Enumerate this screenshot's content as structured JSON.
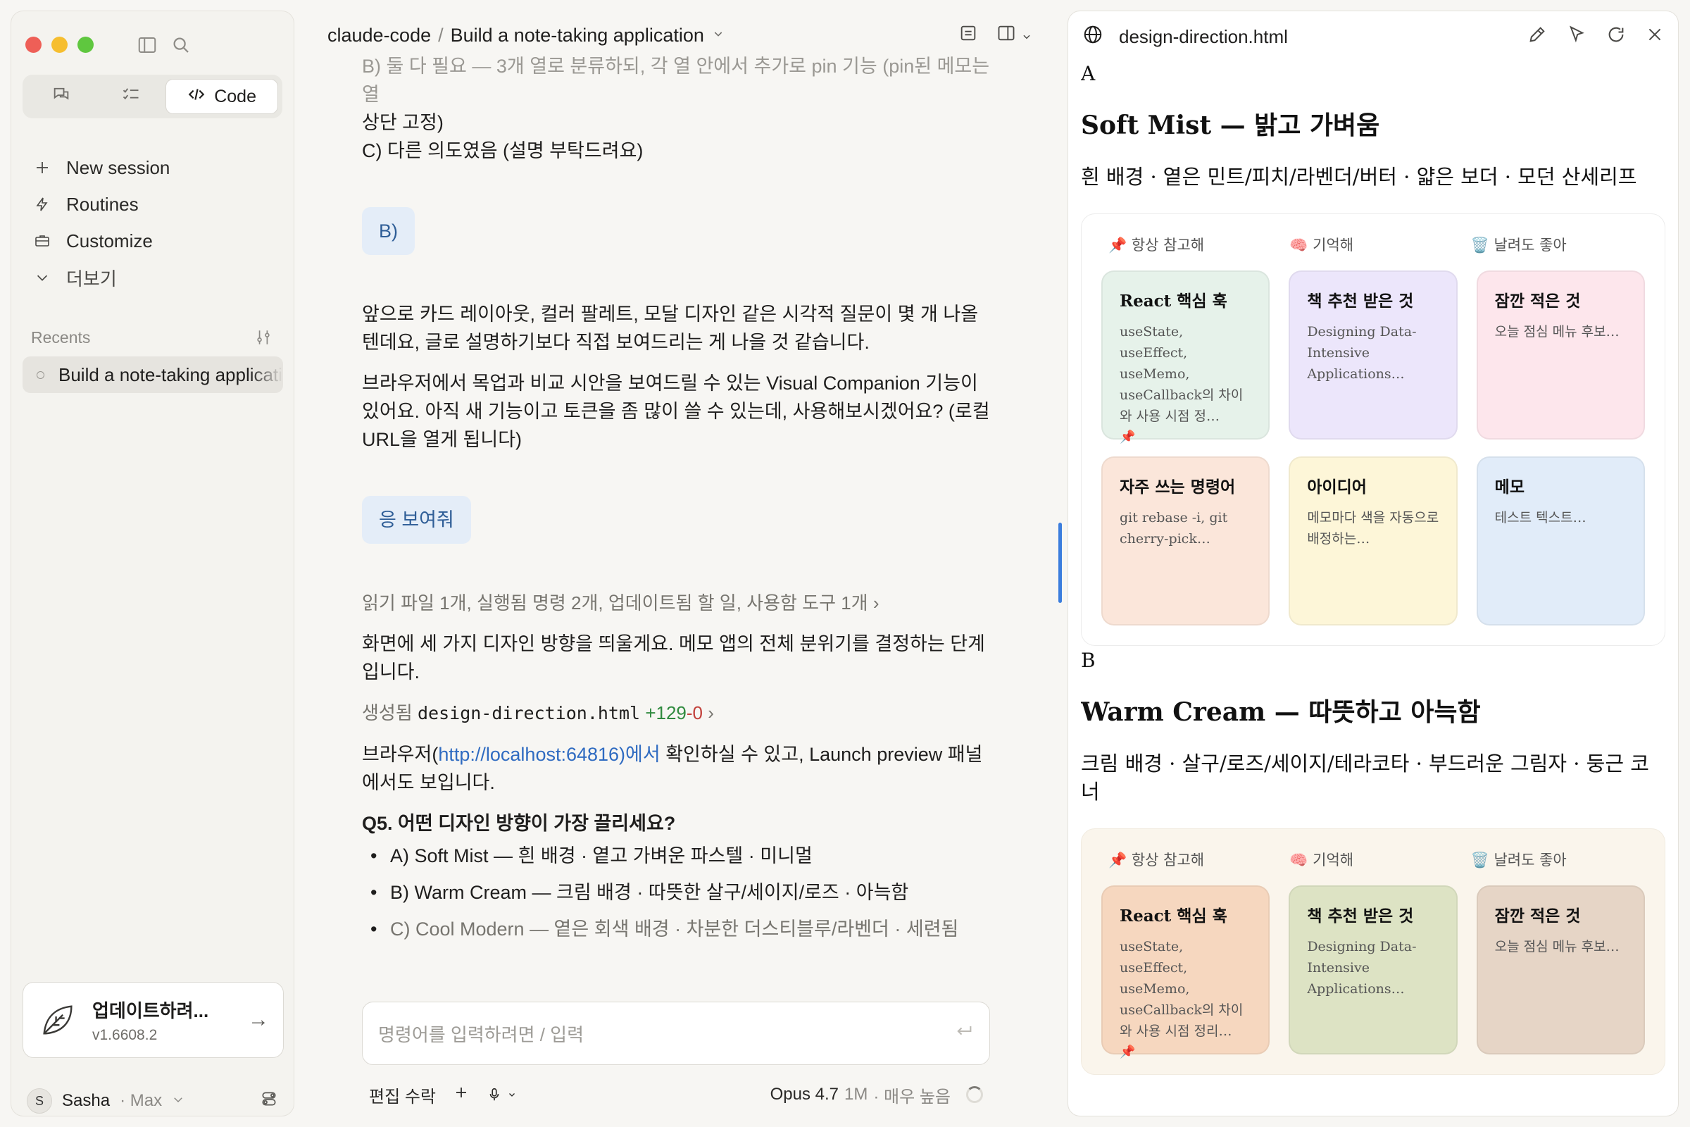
{
  "sidebar": {
    "mode_tabs": [
      {
        "icon": "chat-bubbles-icon"
      },
      {
        "icon": "checklist-icon"
      },
      {
        "icon": "code-brackets-icon",
        "label": "Code"
      }
    ],
    "nav": [
      {
        "label": "New session",
        "icon": "plus-icon"
      },
      {
        "label": "Routines",
        "icon": "bolt-icon"
      },
      {
        "label": "Customize",
        "icon": "briefcase-icon"
      },
      {
        "label": "더보기",
        "icon": "chevron-down-icon"
      }
    ],
    "recents_label": "Recents",
    "recent_item": "Build a note-taking application",
    "update": {
      "title": "업데이트하려...",
      "version": "v1.6608.2"
    },
    "user": {
      "initial": "S",
      "name": "Sasha",
      "plan": "· Max"
    }
  },
  "topbar": {
    "repo": "claude-code",
    "separator": "/",
    "title": "Build a note-taking application"
  },
  "chat": {
    "cut_line": "B) 둘 다 필요 — 3개 열로 분류하되, 각 열 안에서 추가로 pin 기능 (pin된 메모는 열",
    "cut_line2": "상단 고정)",
    "opt_c": "C) 다른 의도였음 (설명 부탁드려요)",
    "user_reply1": "B)",
    "para1": "앞으로 카드 레이아웃, 컬러 팔레트, 모달 디자인 같은 시각적 질문이 몇 개 나올 텐데요, 글로 설명하기보다 직접 보여드리는 게 나을 것 같습니다.",
    "para2": "브라우저에서 목업과 비교 시안을 보여드릴 수 있는 Visual Companion 기능이 있어요. 아직 새 기능이고 토큰을 좀 많이 쓸 수 있는데, 사용해보시겠어요? (로컬 URL을 열게 됩니다)",
    "user_reply2": "응 보여줘",
    "tool_summary": "읽기 파일 1개, 실행됨 명령 2개, 업데이트됨 할 일, 사용함 도구 1개",
    "para3": "화면에 세 가지 디자인 방향을 띄울게요. 메모 앱의 전체 분위기를 결정하는 단계입니다.",
    "created_label": "생성됨",
    "created_file": "design-direction.html",
    "diff_plus": "+129",
    "diff_minus": "-0",
    "browser_pre": "브라우저(",
    "browser_link": "http://localhost:64816)에서",
    "browser_post": " 확인하실 수 있고, Launch preview 패널에서도 보입니다.",
    "question": "Q5. 어떤 디자인 방향이 가장 끌리세요?",
    "options": [
      {
        "key": "A) Soft Mist",
        "desc": " — 흰 배경 · 옅고 가벼운 파스텔 · 미니멀"
      },
      {
        "key": "B) Warm Cream",
        "desc": " — 크림 배경 · 따뜻한 살구/세이지/로즈 · 아늑함"
      },
      {
        "key": "C) Cool Modern",
        "desc": " — 옅은 회색 배경 · 차분한 더스티블루/라벤더 · 세련됨"
      }
    ]
  },
  "composer": {
    "placeholder": "명령어를 입력하려면 / 입력",
    "edit_mode": "편집 수락",
    "model": "Opus 4.7",
    "context": "1M",
    "effort": "· 매우 높음"
  },
  "panel": {
    "filename": "design-direction.html",
    "sections": [
      {
        "letter": "A",
        "title": "Soft Mist — 밝고 가벼움",
        "desc": "흰 배경 · 옅은 민트/피치/라벤더/버터 · 얇은 보더 · 모던 산세리프",
        "columns": [
          "📌 항상 참고해",
          "🧠 기억해",
          "🗑️ 날려도 좋아"
        ],
        "notes": [
          {
            "title": "React 핵심 훅",
            "body": "useState, useEffect, useMemo, useCallback의 차이와 사용 시점 정…",
            "pin": "📌",
            "color": "#e6f2ea"
          },
          {
            "title": "책 추천 받은 것",
            "body": "Designing Data-Intensive Applications…",
            "color": "#ece6fb"
          },
          {
            "title": "잠깐 적은 것",
            "body": "오늘 점심 메뉴 후보…",
            "color": "#fde6ec"
          },
          {
            "title": "자주 쓰는 명령어",
            "body": "git rebase -i, git cherry-pick…",
            "color": "#fbe6da"
          },
          {
            "title": "아이디어",
            "body": "메모마다 색을 자동으로 배정하는…",
            "color": "#fdf6d8"
          },
          {
            "title": "메모",
            "body": "테스트 텍스트…",
            "color": "#e1ecf9"
          }
        ]
      },
      {
        "letter": "B",
        "title": "Warm Cream — 따뜻하고 아늑함",
        "desc": "크림 배경 · 살구/로즈/세이지/테라코타 · 부드러운 그림자 · 둥근 코너",
        "columns": [
          "📌 항상 참고해",
          "🧠 기억해",
          "🗑️ 날려도 좋아"
        ],
        "notes": [
          {
            "title": "React 핵심 훅",
            "body": "useState, useEffect, useMemo, useCallback의 차이와 사용 시점 정리…",
            "pin": "📌",
            "color": "#f6d7bf"
          },
          {
            "title": "책 추천 받은 것",
            "body": "Designing Data-Intensive Applications…",
            "color": "#dde3c4"
          },
          {
            "title": "잠깐 적은 것",
            "body": "오늘 점심 메뉴 후보…",
            "color": "#e6d5c6"
          }
        ]
      }
    ]
  }
}
